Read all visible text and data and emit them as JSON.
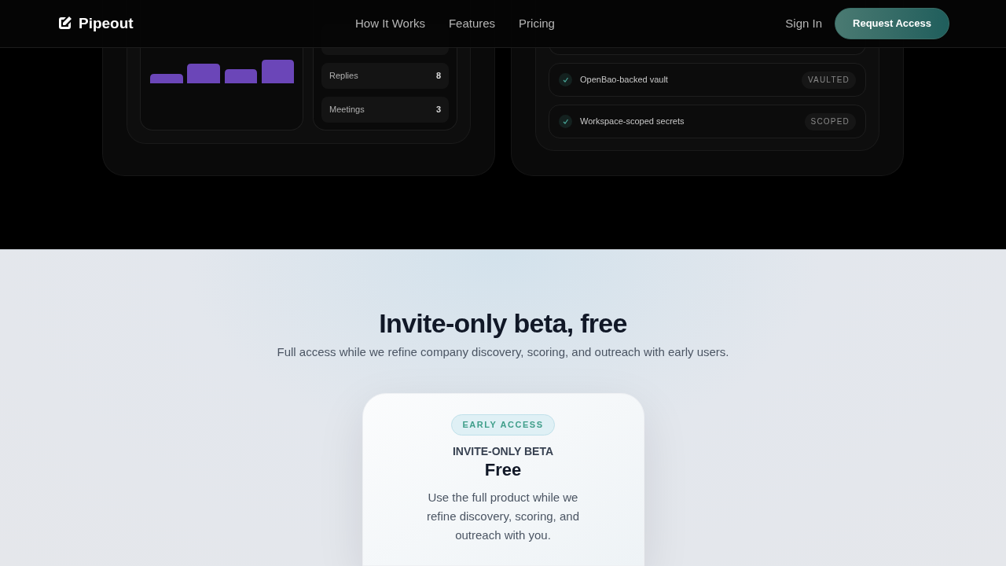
{
  "header": {
    "brand": "Pipeout",
    "nav": [
      "How It Works",
      "Features",
      "Pricing"
    ],
    "sign_in": "Sign In",
    "cta": "Request Access"
  },
  "stats": [
    {
      "label": "Replies",
      "value": "8"
    },
    {
      "label": "Meetings",
      "value": "3"
    }
  ],
  "security": [
    {
      "label": "OpenBao-backed vault",
      "tag": "VAULTED",
      "checked": true
    },
    {
      "label": "Workspace-scoped secrets",
      "tag": "SCOPED",
      "checked": true
    }
  ],
  "pricing": {
    "title": "Invite-only beta, free",
    "subtitle": "Full access while we refine company discovery, scoring, and outreach with early users.",
    "card": {
      "badge": "EARLY ACCESS",
      "plan": "INVITE-ONLY BETA",
      "price": "Free",
      "description": "Use the full product while we refine discovery, scoring, and outreach with you."
    }
  }
}
